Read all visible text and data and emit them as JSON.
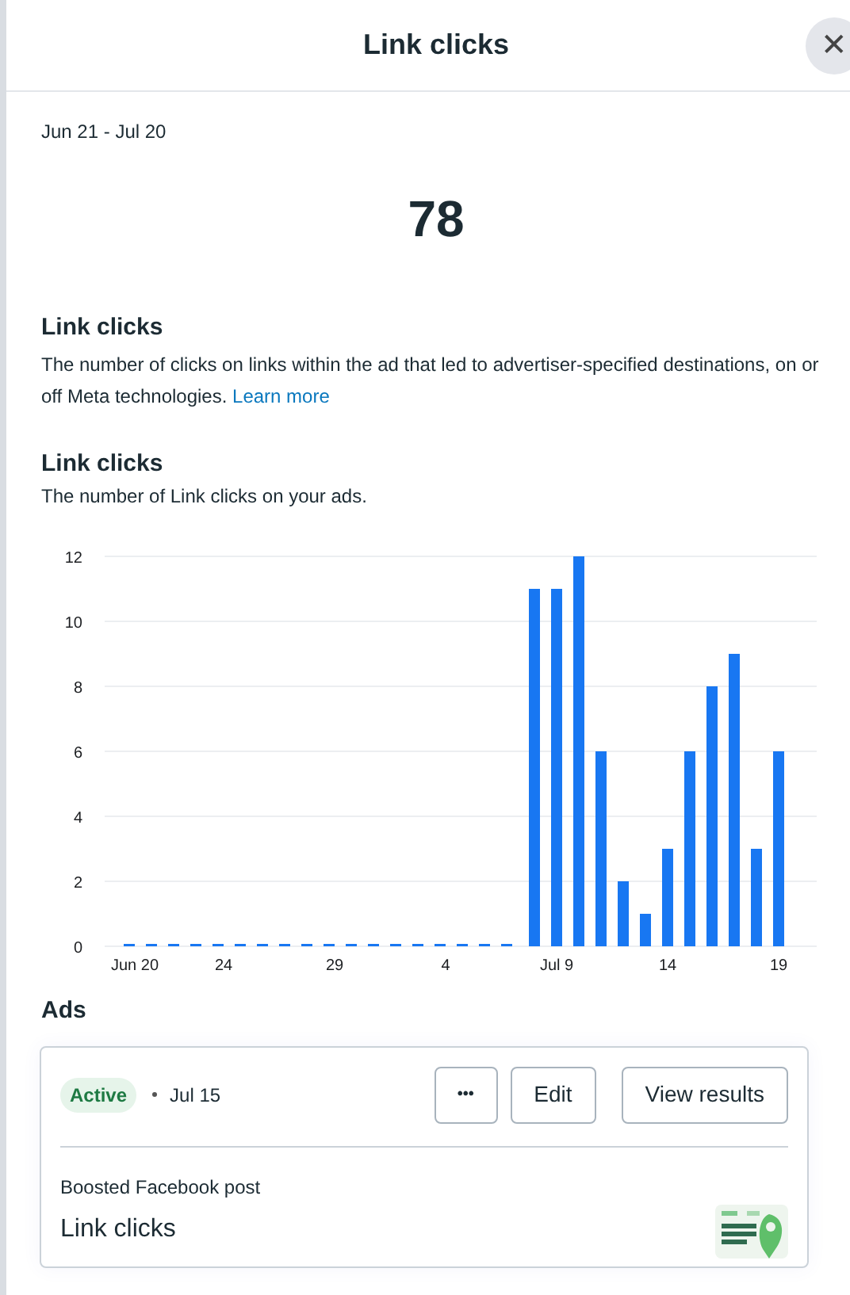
{
  "header": {
    "title": "Link clicks",
    "close_label": "✕"
  },
  "date_range": "Jun 21 - Jul 20",
  "total": "78",
  "definition": {
    "title": "Link clicks",
    "text": "The number of clicks on links within the ad that led to advertiser-specified destinations, on or off Meta technologies.",
    "link": "Learn more"
  },
  "chart_section": {
    "title": "Link clicks",
    "subtitle": "The number of Link clicks on your ads.",
    "chart_data": {
      "type": "bar",
      "categories": [
        "Jun 20",
        null,
        null,
        null,
        "24",
        null,
        null,
        null,
        null,
        "29",
        null,
        null,
        null,
        null,
        "4",
        null,
        null,
        null,
        null,
        "Jul 9",
        null,
        null,
        null,
        null,
        "14",
        null,
        null,
        null,
        null,
        "19"
      ],
      "grid": true,
      "series": [
        {
          "color": "#1877f2",
          "values": [
            0,
            0,
            0,
            0,
            0,
            0,
            0,
            0,
            0,
            0,
            0,
            0,
            0,
            0,
            0,
            0,
            0,
            0,
            11,
            11,
            12,
            6,
            2,
            1,
            3,
            6,
            8,
            9,
            3,
            6
          ]
        }
      ],
      "ylim": [
        0,
        12
      ],
      "yticks": [
        0,
        2,
        4,
        6,
        8,
        10,
        12
      ]
    }
  },
  "ads": {
    "title": "Ads",
    "items": [
      {
        "status": "Active",
        "date": "Jul 15",
        "more_label": "•••",
        "buttons": [
          "Edit",
          "View results"
        ],
        "type": "Boosted Facebook post",
        "objective": "Link clicks"
      }
    ]
  }
}
